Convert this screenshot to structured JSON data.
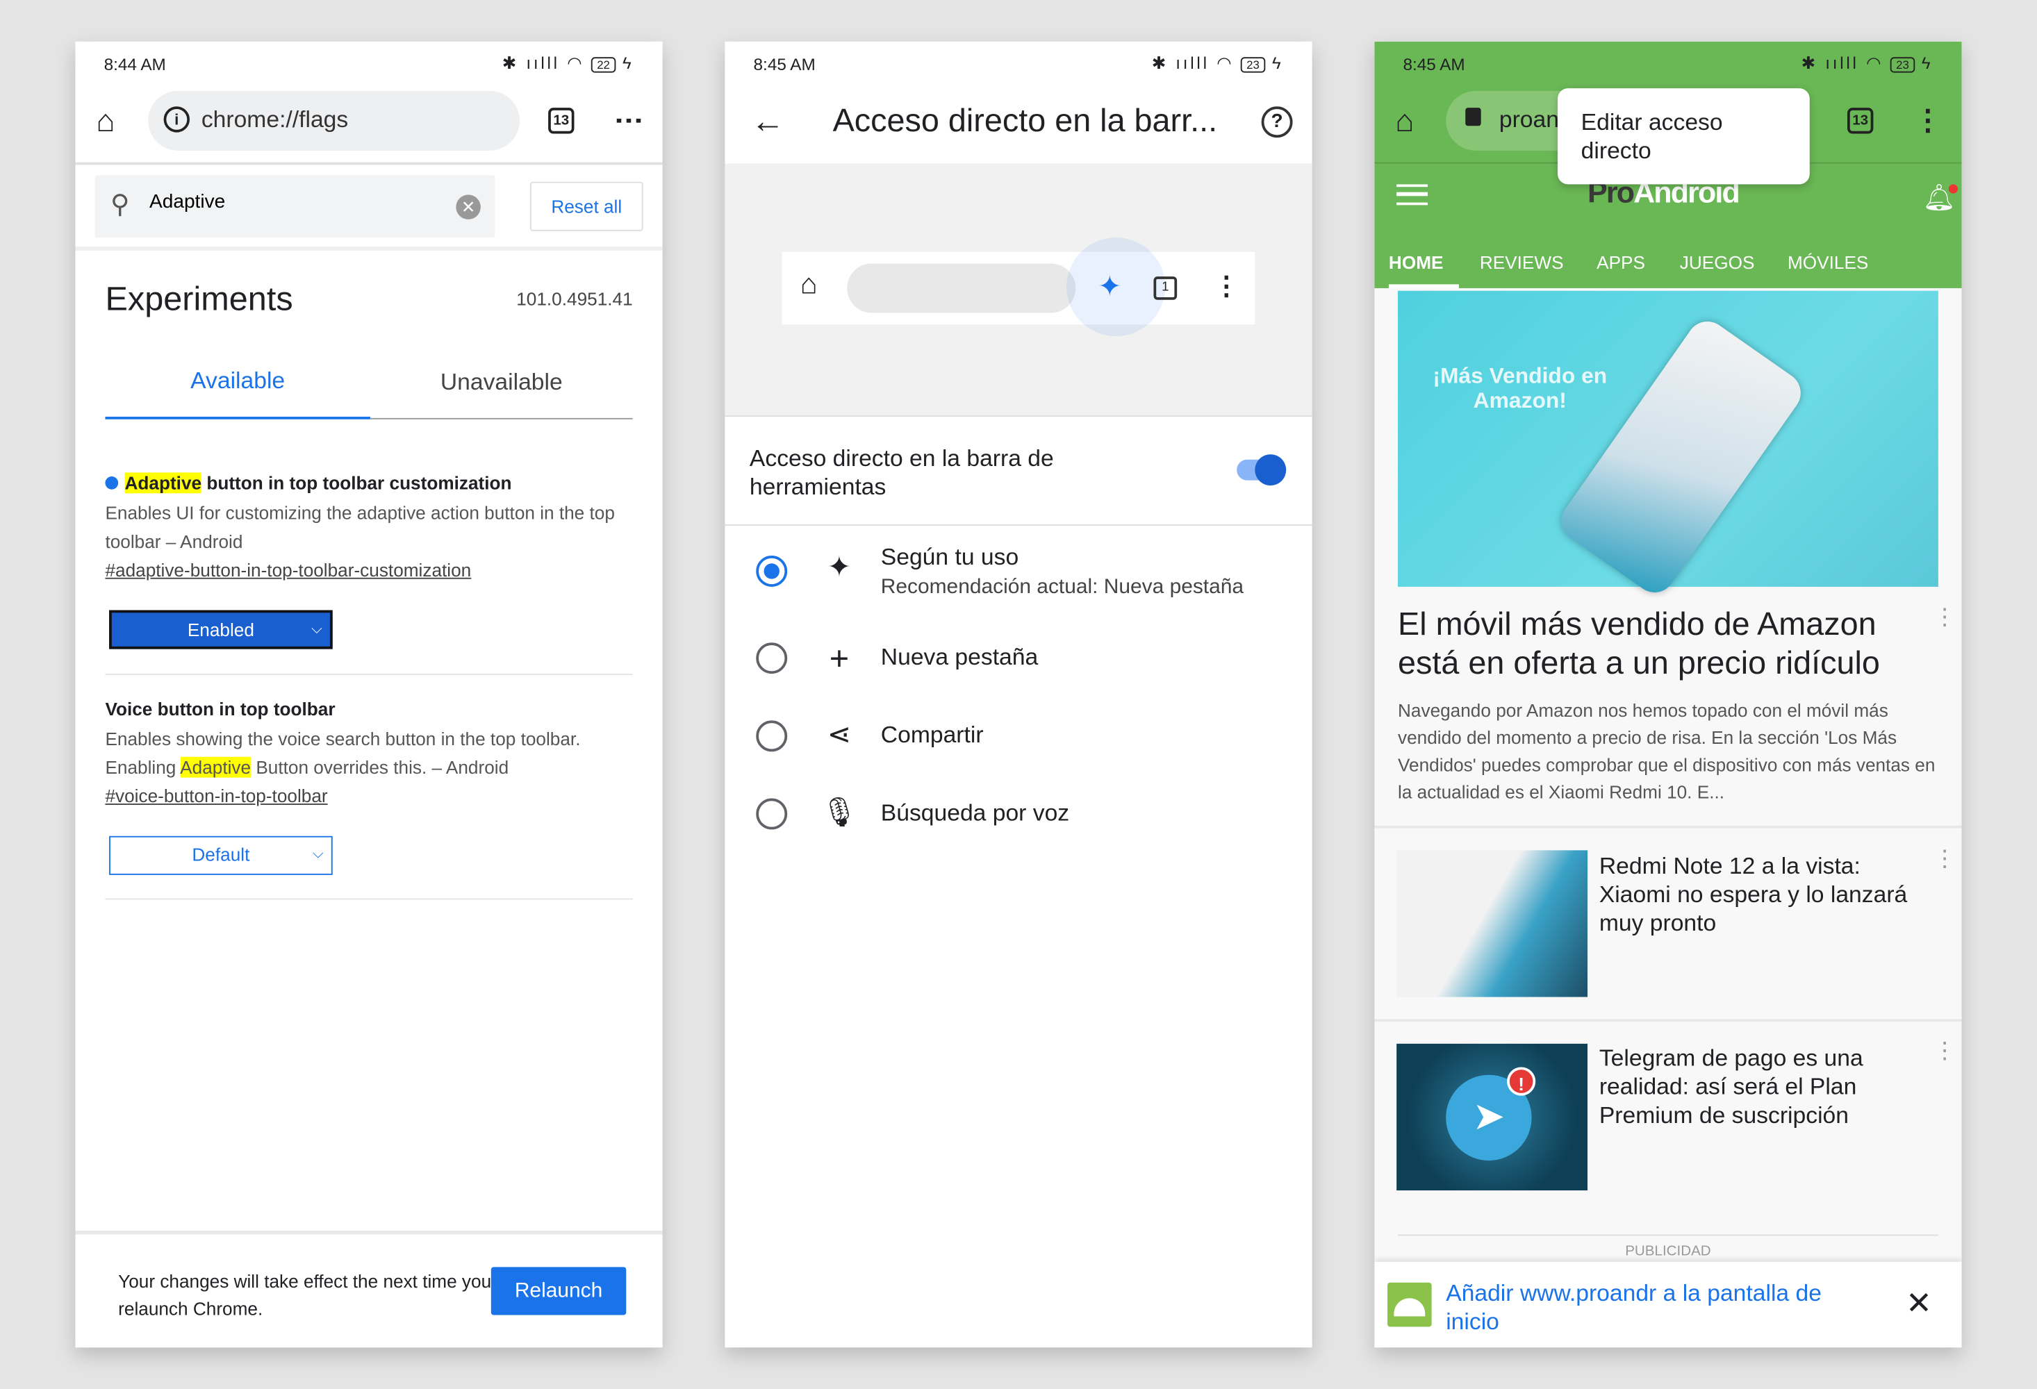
{
  "phone1": {
    "status": {
      "time": "8:44 AM",
      "battery": "22"
    },
    "url": "chrome://flags",
    "tab_count": "13",
    "search": {
      "value": "Adaptive",
      "placeholder": ""
    },
    "reset_all": "Reset all",
    "title": "Experiments",
    "version": "101.0.4951.41",
    "tabs": [
      {
        "label": "Available",
        "active": true
      },
      {
        "label": "Unavailable",
        "active": false
      }
    ],
    "flags": [
      {
        "title_hl": "Adaptive",
        "title_rest": " button in top toolbar customization",
        "desc": "Enables UI for customizing the adaptive action button in the top toolbar – Android",
        "link": "#adaptive-button-in-top-toolbar-customization",
        "value": "Enabled"
      },
      {
        "title": "Voice button in top toolbar",
        "desc_a": "Enables showing the voice search button in the top toolbar. Enabling ",
        "desc_hl": "Adaptive",
        "desc_b": " Button overrides this. – Android",
        "link": "#voice-button-in-top-toolbar",
        "value": "Default"
      }
    ],
    "footer": {
      "message": "Your changes will take effect the next time you relaunch Chrome.",
      "button": "Relaunch"
    }
  },
  "phone2": {
    "status": {
      "time": "8:45 AM",
      "battery": "23"
    },
    "title": "Acceso directo en la barr...",
    "preview_tab_count": "1",
    "toggle": {
      "label": "Acceso directo en la barra de herramientas",
      "on": true
    },
    "options": [
      {
        "label": "Según tu uso",
        "sub": "Recomendación actual: Nueva pestaña",
        "icon": "sparkle-icon",
        "selected": true
      },
      {
        "label": "Nueva pestaña",
        "icon": "plus-icon",
        "selected": false
      },
      {
        "label": "Compartir",
        "icon": "share-icon",
        "selected": false
      },
      {
        "label": "Búsqueda por voz",
        "icon": "mic-icon",
        "selected": false
      }
    ]
  },
  "phone3": {
    "status": {
      "time": "8:45 AM",
      "battery": "23"
    },
    "url_partial": "proan",
    "tab_count": "13",
    "popup": "Editar acceso directo",
    "logo": {
      "pro": "Pro",
      "android": "Android"
    },
    "nav": [
      "HOME",
      "REVIEWS",
      "APPS",
      "JUEGOS",
      "MÓVILES"
    ],
    "hero": {
      "image_text": "¡Más Vendido en Amazon!",
      "title": "El móvil más vendido de Amazon está en oferta a un precio ridículo",
      "excerpt": "Navegando por Amazon nos hemos topado con el móvil más vendido del momento a precio de risa. En la sección 'Los Más Vendidos' puedes comprobar que el dispositivo con más ventas en la actualidad es el Xiaomi Redmi 10. E..."
    },
    "articles": [
      {
        "title": "Redmi Note 12 a la vista: Xiaomi no espera y lo lanzará muy pronto"
      },
      {
        "title": "Telegram de pago es una realidad: así será el Plan Premium de suscripción"
      }
    ],
    "ad_label": "PUBLICIDAD",
    "install_banner": "Añadir www.proandr a la pantalla de inicio",
    "colors": {
      "green": "#6ab755",
      "accent": "#1a73e8"
    }
  }
}
